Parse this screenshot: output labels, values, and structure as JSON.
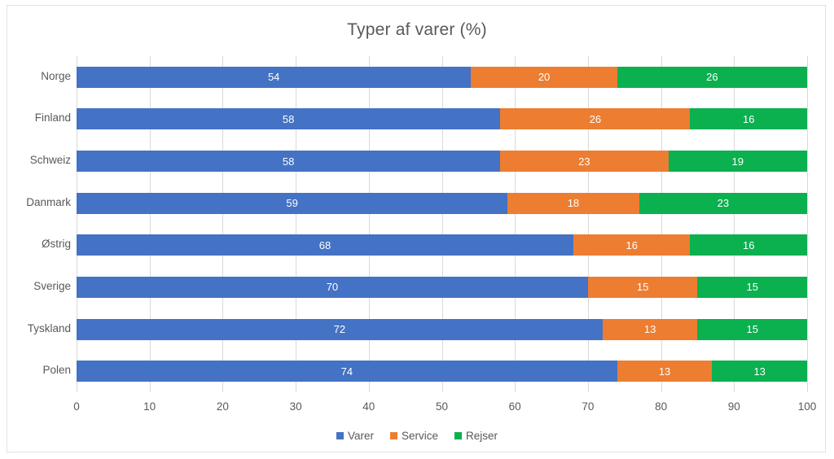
{
  "chart_data": {
    "type": "bar",
    "orientation": "horizontal",
    "stacked": true,
    "stack_mode": "percent",
    "title": "Typer af varer (%)",
    "xlabel": "",
    "ylabel": "",
    "xlim": [
      0,
      100
    ],
    "x_ticks": [
      0,
      10,
      20,
      30,
      40,
      50,
      60,
      70,
      80,
      90,
      100
    ],
    "x_tick_labels": [
      "0",
      "10",
      "20",
      "30",
      "40",
      "50",
      "60",
      "70",
      "80",
      "90",
      "100"
    ],
    "grid": "vertical",
    "legend_position": "bottom",
    "categories": [
      "Norge",
      "Finland",
      "Schweiz",
      "Danmark",
      "Østrig",
      "Sverige",
      "Tyskland",
      "Polen"
    ],
    "series": [
      {
        "name": "Varer",
        "color": "#4472C4",
        "values": [
          54,
          58,
          58,
          59,
          68,
          70,
          72,
          74
        ]
      },
      {
        "name": "Service",
        "color": "#ED7D31",
        "values": [
          20,
          26,
          23,
          18,
          16,
          15,
          13,
          13
        ]
      },
      {
        "name": "Rejser",
        "color": "#0BB04F",
        "values": [
          26,
          16,
          19,
          23,
          16,
          15,
          15,
          13
        ]
      }
    ],
    "data_labels": true,
    "colors": {
      "series_1": "#4472C4",
      "series_2": "#ED7D31",
      "series_3": "#0BB04F",
      "text": "#595959",
      "gridline": "#D9D9D9",
      "frame": "#E3E3E3",
      "background": "#FFFFFF"
    }
  }
}
